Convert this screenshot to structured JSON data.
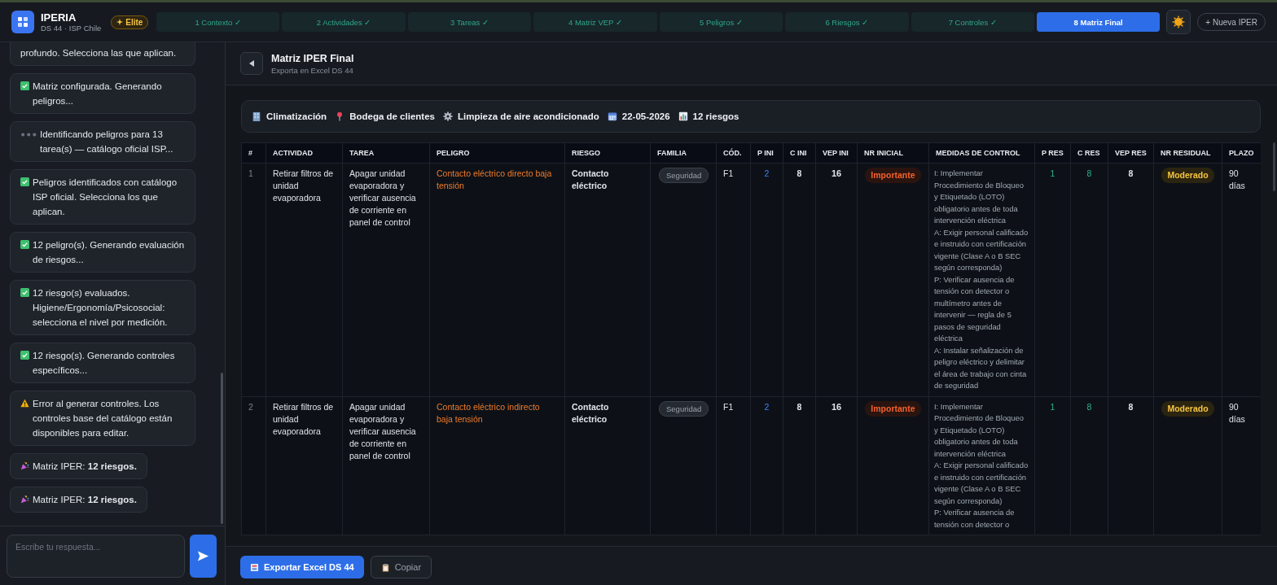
{
  "app": {
    "name": "IPERIA",
    "subtitle": "DS 44 · ISP Chile",
    "badge": "Elite"
  },
  "steps": [
    {
      "label": "1 Contexto ✓",
      "selected": false
    },
    {
      "label": "2 Actividades ✓",
      "selected": false
    },
    {
      "label": "3 Tareas ✓",
      "selected": false
    },
    {
      "label": "4 Matriz VEP ✓",
      "selected": false
    },
    {
      "label": "5 Peligros ✓",
      "selected": false
    },
    {
      "label": "6 Riesgos ✓",
      "selected": false
    },
    {
      "label": "7 Controles ✓",
      "selected": false
    },
    {
      "label": "8 Matriz Final",
      "selected": true
    }
  ],
  "new_button": "+ Nueva IPER",
  "chat": {
    "messages": [
      {
        "kind": "plain",
        "text": "profundo. Selecciona las que aplican."
      },
      {
        "kind": "ok",
        "text": "Matriz configurada. Generando peligros..."
      },
      {
        "kind": "loading",
        "text": "Identificando peligros para 13 tarea(s) — catálogo oficial ISP..."
      },
      {
        "kind": "ok",
        "text": "Peligros identificados con catálogo ISP oficial. Selecciona los que aplican."
      },
      {
        "kind": "ok",
        "text": "12 peligro(s). Generando evaluación de riesgos..."
      },
      {
        "kind": "ok",
        "text": "12 riesgo(s) evaluados. Higiene/Ergonomía/Psicosocial: selecciona el nivel por medición."
      },
      {
        "kind": "ok",
        "text": "12 riesgo(s). Generando controles específicos..."
      },
      {
        "kind": "warn",
        "text": "Error al generar controles. Los controles base del catálogo están disponibles para editar."
      },
      {
        "kind": "party",
        "text": "Matriz IPER: **12 riesgos.**"
      },
      {
        "kind": "party",
        "text": "Matriz IPER: **12 riesgos.**"
      }
    ],
    "input_placeholder": "Escribe tu respuesta..."
  },
  "page": {
    "title": "Matriz IPER Final",
    "subtitle": "Exporta en Excel DS 44"
  },
  "summary": [
    {
      "kind": "area",
      "text": "Climatización"
    },
    {
      "kind": "place",
      "text": "Bodega de clientes"
    },
    {
      "kind": "process",
      "text": "Limpieza de aire acondicionado"
    },
    {
      "kind": "date",
      "text": "22-05-2026"
    },
    {
      "kind": "count",
      "text": "12 riesgos"
    }
  ],
  "table": {
    "columns": [
      "#",
      "ACTIVIDAD",
      "TAREA",
      "PELIGRO",
      "RIESGO",
      "FAMILIA",
      "CÓD.",
      "P INI",
      "C INI",
      "VEP INI",
      "NR INICIAL",
      "MEDIDAS DE CONTROL",
      "P RES",
      "C RES",
      "VEP RES",
      "NR RESIDUAL",
      "PLAZO"
    ],
    "rows": [
      {
        "num": "1",
        "actividad": "Retirar filtros de unidad evaporadora",
        "tarea": "Apagar unidad evaporadora y verificar ausencia de corriente en panel de control",
        "peligro": "Contacto eléctrico directo baja tensión",
        "riesgo": "Contacto eléctrico",
        "familia": "Seguridad",
        "cod": "F1",
        "p_ini": "2",
        "c_ini": "8",
        "vep_ini": "16",
        "nr_inicial": {
          "text": "Importante",
          "kind": "importante"
        },
        "medidas": [
          "I: Implementar Procedimiento de Bloqueo y Etiquetado (LOTO) obligatorio antes de toda intervención eléctrica",
          "A: Exigir personal calificado e instruido con certificación vigente (Clase A o B SEC según corresponda)",
          "P: Verificar ausencia de tensión con detector o multímetro antes de intervenir — regla de 5 pasos de seguridad eléctrica",
          "A: Instalar señalización de peligro eléctrico y delimitar el área de trabajo con cinta de seguridad"
        ],
        "p_res": "1",
        "c_res": "8",
        "vep_res": "8",
        "nr_residual": {
          "text": "Moderado",
          "kind": "moderado"
        },
        "plazo": "90 días"
      },
      {
        "num": "2",
        "actividad": "Retirar filtros de unidad evaporadora",
        "tarea": "Apagar unidad evaporadora y verificar ausencia de corriente en panel de control",
        "peligro": "Contacto eléctrico indirecto baja tensión",
        "riesgo": "Contacto eléctrico",
        "familia": "Seguridad",
        "cod": "F1",
        "p_ini": "2",
        "c_ini": "8",
        "vep_ini": "16",
        "nr_inicial": {
          "text": "Importante",
          "kind": "importante"
        },
        "medidas": [
          "I: Implementar Procedimiento de Bloqueo y Etiquetado (LOTO) obligatorio antes de toda intervención eléctrica",
          "A: Exigir personal calificado e instruido con certificación vigente (Clase A o B SEC según corresponda)",
          "P: Verificar ausencia de tensión con detector o"
        ],
        "p_res": "1",
        "c_res": "8",
        "vep_res": "8",
        "nr_residual": {
          "text": "Moderado",
          "kind": "moderado"
        },
        "plazo": "90 días"
      }
    ]
  },
  "footer": {
    "export_button": "Exportar Excel DS 44",
    "copy_button": "Copiar"
  }
}
